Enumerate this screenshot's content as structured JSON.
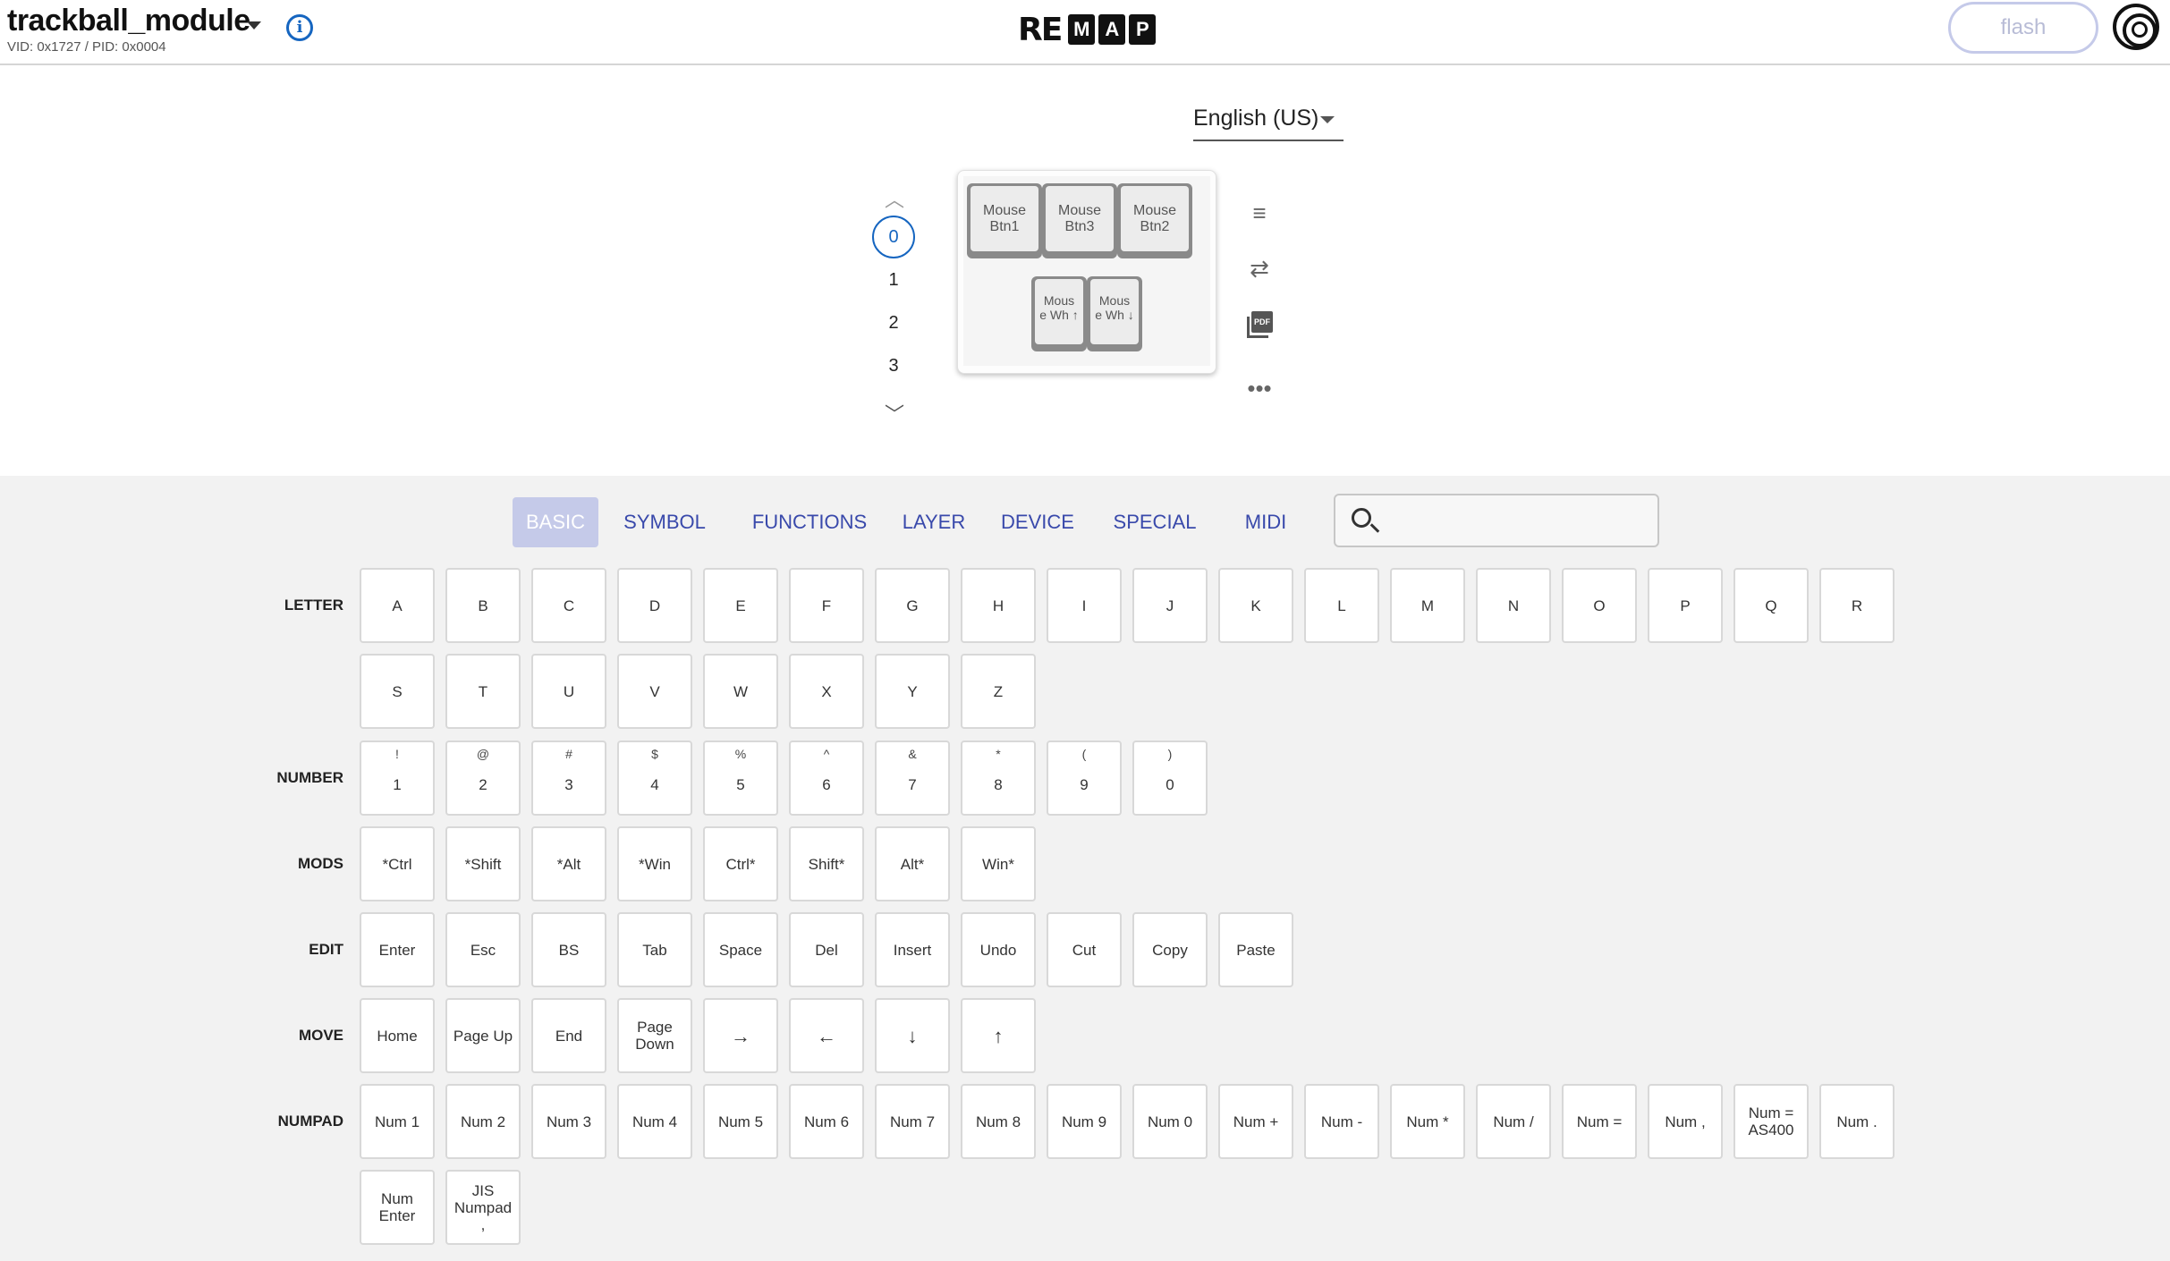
{
  "header": {
    "keyboard_name": "trackball_module",
    "vid_pid": "VID: 0x1727 / PID: 0x0004",
    "logo_prefix": "RE",
    "logo_letters": [
      "M",
      "A",
      "P"
    ],
    "flash_label": "flash"
  },
  "language": {
    "selected": "English (US)"
  },
  "layers": [
    "0",
    "1",
    "2",
    "3"
  ],
  "active_layer": "0",
  "keymap": {
    "top_keys": [
      {
        "label": "Mouse Btn1"
      },
      {
        "label": "Mouse Btn3"
      },
      {
        "label": "Mouse Btn2"
      }
    ],
    "bottom_keys": [
      {
        "label": "Mouse Wh ↑",
        "line1": "Mous",
        "line2": "e Wh ↑"
      },
      {
        "label": "Mouse Wh ↓",
        "line1": "Mous",
        "line2": "e Wh ↓"
      }
    ]
  },
  "tabs": [
    {
      "label": "BASIC",
      "active": true
    },
    {
      "label": "SYMBOL"
    },
    {
      "label": "FUNCTIONS"
    },
    {
      "label": "LAYER"
    },
    {
      "label": "DEVICE"
    },
    {
      "label": "SPECIAL"
    },
    {
      "label": "MIDI"
    }
  ],
  "search": {
    "placeholder": ""
  },
  "categories": {
    "letter": {
      "label": "LETTER",
      "row1": [
        "A",
        "B",
        "C",
        "D",
        "E",
        "F",
        "G",
        "H",
        "I",
        "J",
        "K",
        "L",
        "M",
        "N",
        "O",
        "P",
        "Q",
        "R"
      ],
      "row2": [
        "S",
        "T",
        "U",
        "V",
        "W",
        "X",
        "Y",
        "Z"
      ]
    },
    "number": {
      "label": "NUMBER",
      "keys": [
        {
          "shift": "!",
          "main": "1"
        },
        {
          "shift": "@",
          "main": "2"
        },
        {
          "shift": "#",
          "main": "3"
        },
        {
          "shift": "$",
          "main": "4"
        },
        {
          "shift": "%",
          "main": "5"
        },
        {
          "shift": "^",
          "main": "6"
        },
        {
          "shift": "&",
          "main": "7"
        },
        {
          "shift": "*",
          "main": "8"
        },
        {
          "shift": "(",
          "main": "9"
        },
        {
          "shift": ")",
          "main": "0"
        }
      ]
    },
    "mods": {
      "label": "MODS",
      "keys": [
        "*Ctrl",
        "*Shift",
        "*Alt",
        "*Win",
        "Ctrl*",
        "Shift*",
        "Alt*",
        "Win*"
      ]
    },
    "edit": {
      "label": "EDIT",
      "keys": [
        "Enter",
        "Esc",
        "BS",
        "Tab",
        "Space",
        "Del",
        "Insert",
        "Undo",
        "Cut",
        "Copy",
        "Paste"
      ]
    },
    "move": {
      "label": "MOVE",
      "keys": [
        "Home",
        "Page Up",
        "End",
        "Page Down",
        "→",
        "←",
        "↓",
        "↑"
      ]
    },
    "numpad": {
      "label": "NUMPAD",
      "row1": [
        "Num 1",
        "Num 2",
        "Num 3",
        "Num 4",
        "Num 5",
        "Num 6",
        "Num 7",
        "Num 8",
        "Num 9",
        "Num 0",
        "Num +",
        "Num -",
        "Num *",
        "Num /",
        "Num =",
        "Num ,",
        "Num = AS400",
        "Num ."
      ],
      "row2": [
        "Num Enter",
        "JIS Numpad ,"
      ]
    }
  }
}
